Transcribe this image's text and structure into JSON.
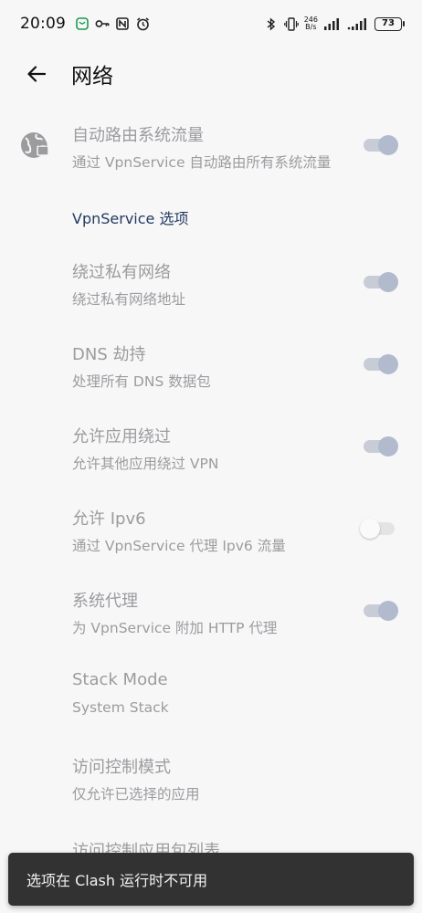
{
  "status_bar": {
    "time": "20:09",
    "net_speed_value": "246",
    "net_speed_unit": "B/s",
    "battery": "73",
    "icons": [
      "app-notification-icon",
      "key-icon",
      "nfc-icon",
      "alarm-icon",
      "bluetooth-icon",
      "vibrate-icon",
      "signal-icon",
      "signal-icon"
    ]
  },
  "toolbar": {
    "title": "网络"
  },
  "settings": {
    "auto_route": {
      "title": "自动路由系统流量",
      "summary": "通过 VpnService 自动路由所有系统流量",
      "enabled": true
    },
    "section_header": "VpnService 选项",
    "bypass_private": {
      "title": "绕过私有网络",
      "summary": "绕过私有网络地址",
      "enabled": true
    },
    "dns_hijack": {
      "title": "DNS 劫持",
      "summary": "处理所有 DNS 数据包",
      "enabled": true
    },
    "allow_bypass": {
      "title": "允许应用绕过",
      "summary": "允许其他应用绕过 VPN",
      "enabled": true
    },
    "allow_ipv6": {
      "title": "允许 Ipv6",
      "summary": "通过 VpnService 代理 Ipv6 流量",
      "enabled": false
    },
    "system_proxy": {
      "title": "系统代理",
      "summary": "为 VpnService 附加 HTTP 代理",
      "enabled": true
    },
    "stack_mode": {
      "title": "Stack Mode",
      "summary": "System Stack"
    },
    "access_control_mode": {
      "title": "访问控制模式",
      "summary": "仅允许已选择的应用"
    },
    "access_control_list": {
      "title": "访问控制应用包列表"
    }
  },
  "snackbar": {
    "text": "选项在 Clash 运行时不可用"
  },
  "colors": {
    "background": "#f7f7f8",
    "disabled_text": "#9c9c9f",
    "section_header": "#233a5f",
    "switch_thumb": "#b1bbcd",
    "snackbar_bg": "#323232"
  }
}
